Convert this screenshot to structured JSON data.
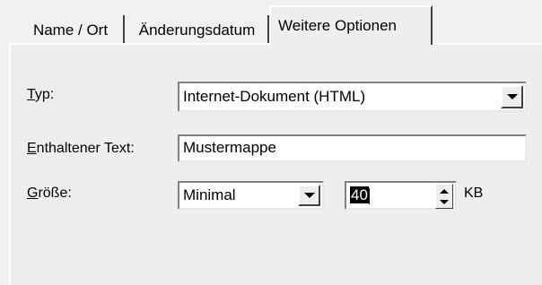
{
  "tabs": [
    {
      "label": "Name / Ort",
      "active": false
    },
    {
      "label": "Änderungsdatum",
      "active": false
    },
    {
      "label": "Weitere Optionen",
      "active": true
    }
  ],
  "form": {
    "type_label_underline": "T",
    "type_label_rest": "yp:",
    "type_value": "Internet-Dokument (HTML)",
    "text_label_underline": "E",
    "text_label_rest": "nthaltener Text:",
    "text_value": "Mustermappe",
    "size_label_underline": "G",
    "size_label_rest": "röße:",
    "size_mode_value": "Minimal",
    "size_number_value": "40",
    "size_unit": "KB"
  },
  "icons": {
    "dropdown": "chevron-down-icon",
    "spin_up": "spin-up-icon",
    "spin_down": "spin-down-icon"
  }
}
